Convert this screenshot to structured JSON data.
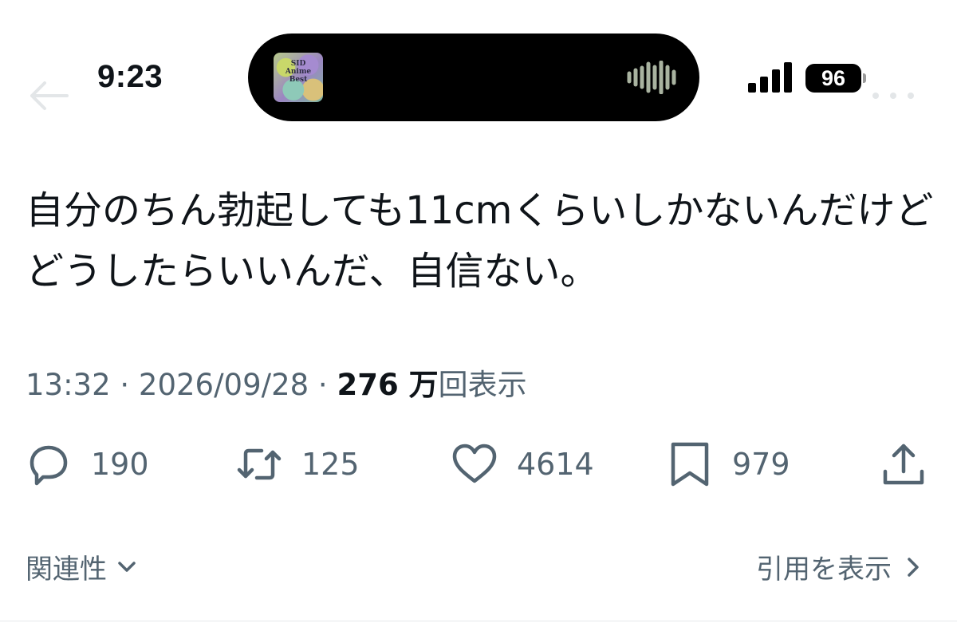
{
  "status_bar": {
    "time": "9:23",
    "battery": "96",
    "now_playing_art": {
      "lines": [
        "SID",
        "Anime",
        "Best"
      ],
      "description": "album-art-thumbnail"
    }
  },
  "tweet": {
    "text": "自分のちん勃起しても11cmくらいしかないんだけどどうしたらいいんだ、自信ない。",
    "timestamp": "13:32 · 2026/09/28 · ",
    "views_count": "276 万",
    "views_label": "回表示"
  },
  "actions": {
    "reply": {
      "icon": "reply-icon",
      "count": "190"
    },
    "retweet": {
      "icon": "retweet-icon",
      "count": "125"
    },
    "like": {
      "icon": "heart-icon",
      "count": "4614"
    },
    "bookmark": {
      "icon": "bookmark-icon",
      "count": "979"
    },
    "share": {
      "icon": "share-icon"
    }
  },
  "footer": {
    "sort_label": "関連性",
    "quotes_label": "引用を表示"
  },
  "colors": {
    "text": "#0f1419",
    "secondary": "#536471",
    "divider": "#e6e9eb"
  }
}
